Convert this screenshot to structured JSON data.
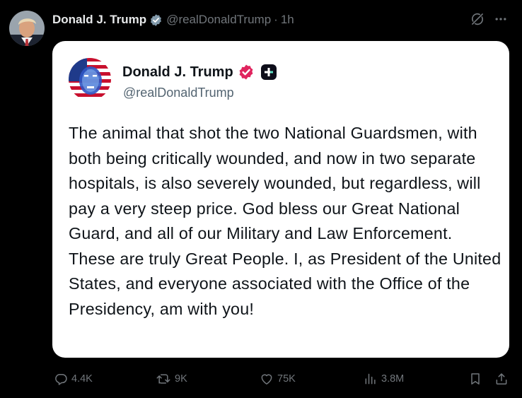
{
  "post": {
    "author_name": "Donald J. Trump",
    "author_handle": "@realDonaldTrump",
    "separator": "·",
    "time": "1h"
  },
  "embedded_card": {
    "author_name": "Donald J. Trump",
    "author_handle": "@realDonaldTrump",
    "text": "The animal that shot the two National Guardsmen, with both being critically wounded, and now in two separate hospitals, is also severely wounded, but regardless, will pay a very steep price. God bless our Great National Guard, and all of our Military and Law Enforcement. These are truly Great People. I, as President of the United States, and everyone associated with the Office of the Presidency, am with you!"
  },
  "actions": {
    "replies": "4.4K",
    "reposts": "9K",
    "likes": "75K",
    "views": "3.8M"
  },
  "icons": {
    "verified": "verified-badge-icon",
    "grok": "grok-icon",
    "more": "more-icon",
    "reply": "reply-icon",
    "repost": "repost-icon",
    "like": "like-icon",
    "views": "views-icon",
    "bookmark": "bookmark-icon",
    "share": "share-icon",
    "app": "truth-social-icon"
  },
  "colors": {
    "background": "#000000",
    "text_primary": "#e7e9ea",
    "text_secondary": "#71767b",
    "verified_gray": "#829aab",
    "verified_pink": "#e0245e",
    "card_background": "#ffffff"
  }
}
